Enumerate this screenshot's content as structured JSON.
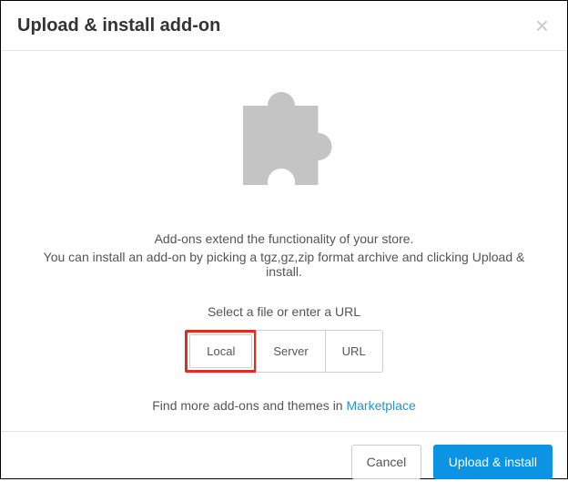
{
  "header": {
    "title": "Upload & install add-on",
    "close_label": "×"
  },
  "body": {
    "desc_line1": "Add-ons extend the functionality of your store.",
    "desc_line2": "You can install an add-on by picking a tgz,gz,zip format archive and clicking Upload & install.",
    "select_label": "Select a file or enter a URL",
    "source_buttons": {
      "local": "Local",
      "server": "Server",
      "url": "URL"
    },
    "marketplace_prefix": "Find more add-ons and themes in ",
    "marketplace_link": "Marketplace"
  },
  "footer": {
    "cancel": "Cancel",
    "submit": "Upload & install"
  }
}
